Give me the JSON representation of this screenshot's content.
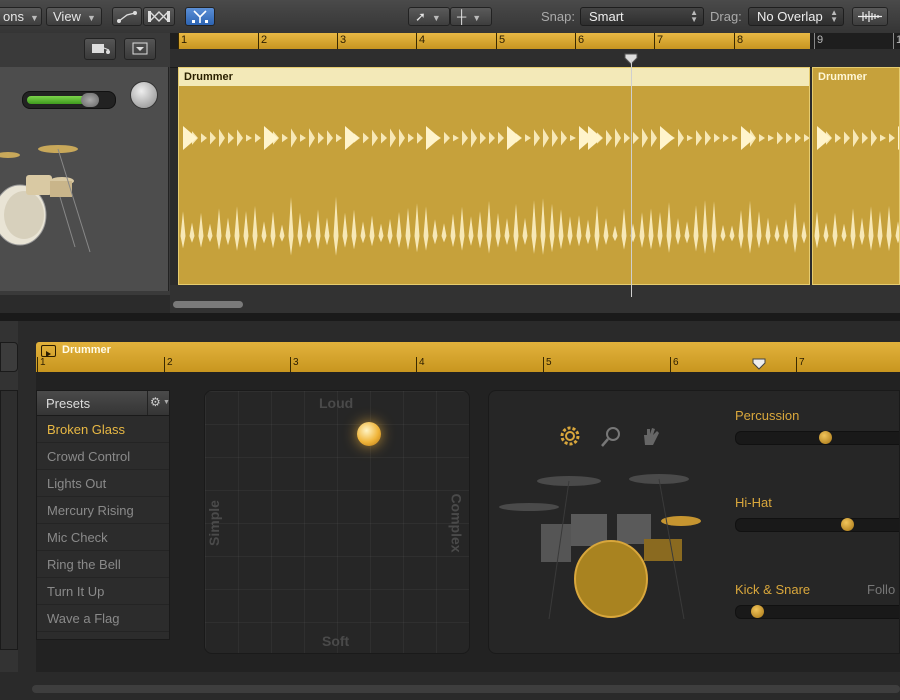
{
  "toolbar": {
    "functions_label": "ons",
    "view_label": "View",
    "snap_label": "Snap:",
    "snap_value": "Smart",
    "drag_label": "Drag:",
    "drag_value": "No Overlap"
  },
  "ruler": {
    "bars": [
      "1",
      "2",
      "3",
      "4",
      "5",
      "6",
      "7",
      "8",
      "9",
      "1"
    ]
  },
  "regions": [
    {
      "name": "Drummer"
    },
    {
      "name": "Drummer"
    }
  ],
  "editor": {
    "region_name": "Drummer",
    "bars": [
      "1",
      "2",
      "3",
      "4",
      "5",
      "6",
      "7"
    ],
    "presets_title": "Presets",
    "presets": [
      "Broken Glass",
      "Crowd Control",
      "Lights Out",
      "Mercury Rising",
      "Mic Check",
      "Ring the Bell",
      "Turn It Up",
      "Wave a Flag"
    ],
    "selected_preset": "Broken Glass",
    "xy_pad": {
      "top": "Loud",
      "bottom": "Soft",
      "left": "Simple",
      "right": "Complex"
    },
    "kit": {
      "percussion_label": "Percussion",
      "hihat_label": "Hi-Hat",
      "kick_snare_label": "Kick & Snare",
      "follow_label": "Follo",
      "percussion_level": 0.55,
      "hihat_level": 0.7,
      "kick_snare_level": 0.1
    }
  },
  "colors": {
    "accent": "#e8b844",
    "region": "#c6a13b",
    "background": "#2b2b2b"
  },
  "icons": [
    "gear-icon",
    "magnifier-icon",
    "hand-icon",
    "pointer-tool-icon",
    "crosshair-tool-icon",
    "waveform-icon"
  ]
}
